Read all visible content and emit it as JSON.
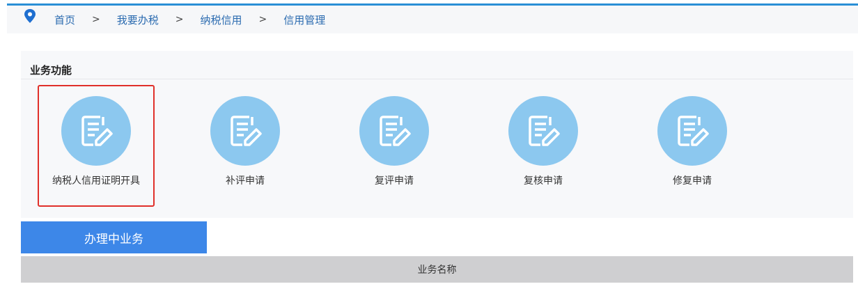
{
  "breadcrumb": [
    "首页",
    "我要办税",
    "纳税信用",
    "信用管理"
  ],
  "breadcrumb_separator": ">",
  "section_title": "业务功能",
  "functions": [
    {
      "label": "纳税人信用证明开具",
      "selected": true
    },
    {
      "label": "补评申请"
    },
    {
      "label": "复评申请"
    },
    {
      "label": "复核申请"
    },
    {
      "label": "修复申请"
    }
  ],
  "tab_label": "办理中业务",
  "table": {
    "columns": [
      "业务名称"
    ]
  }
}
